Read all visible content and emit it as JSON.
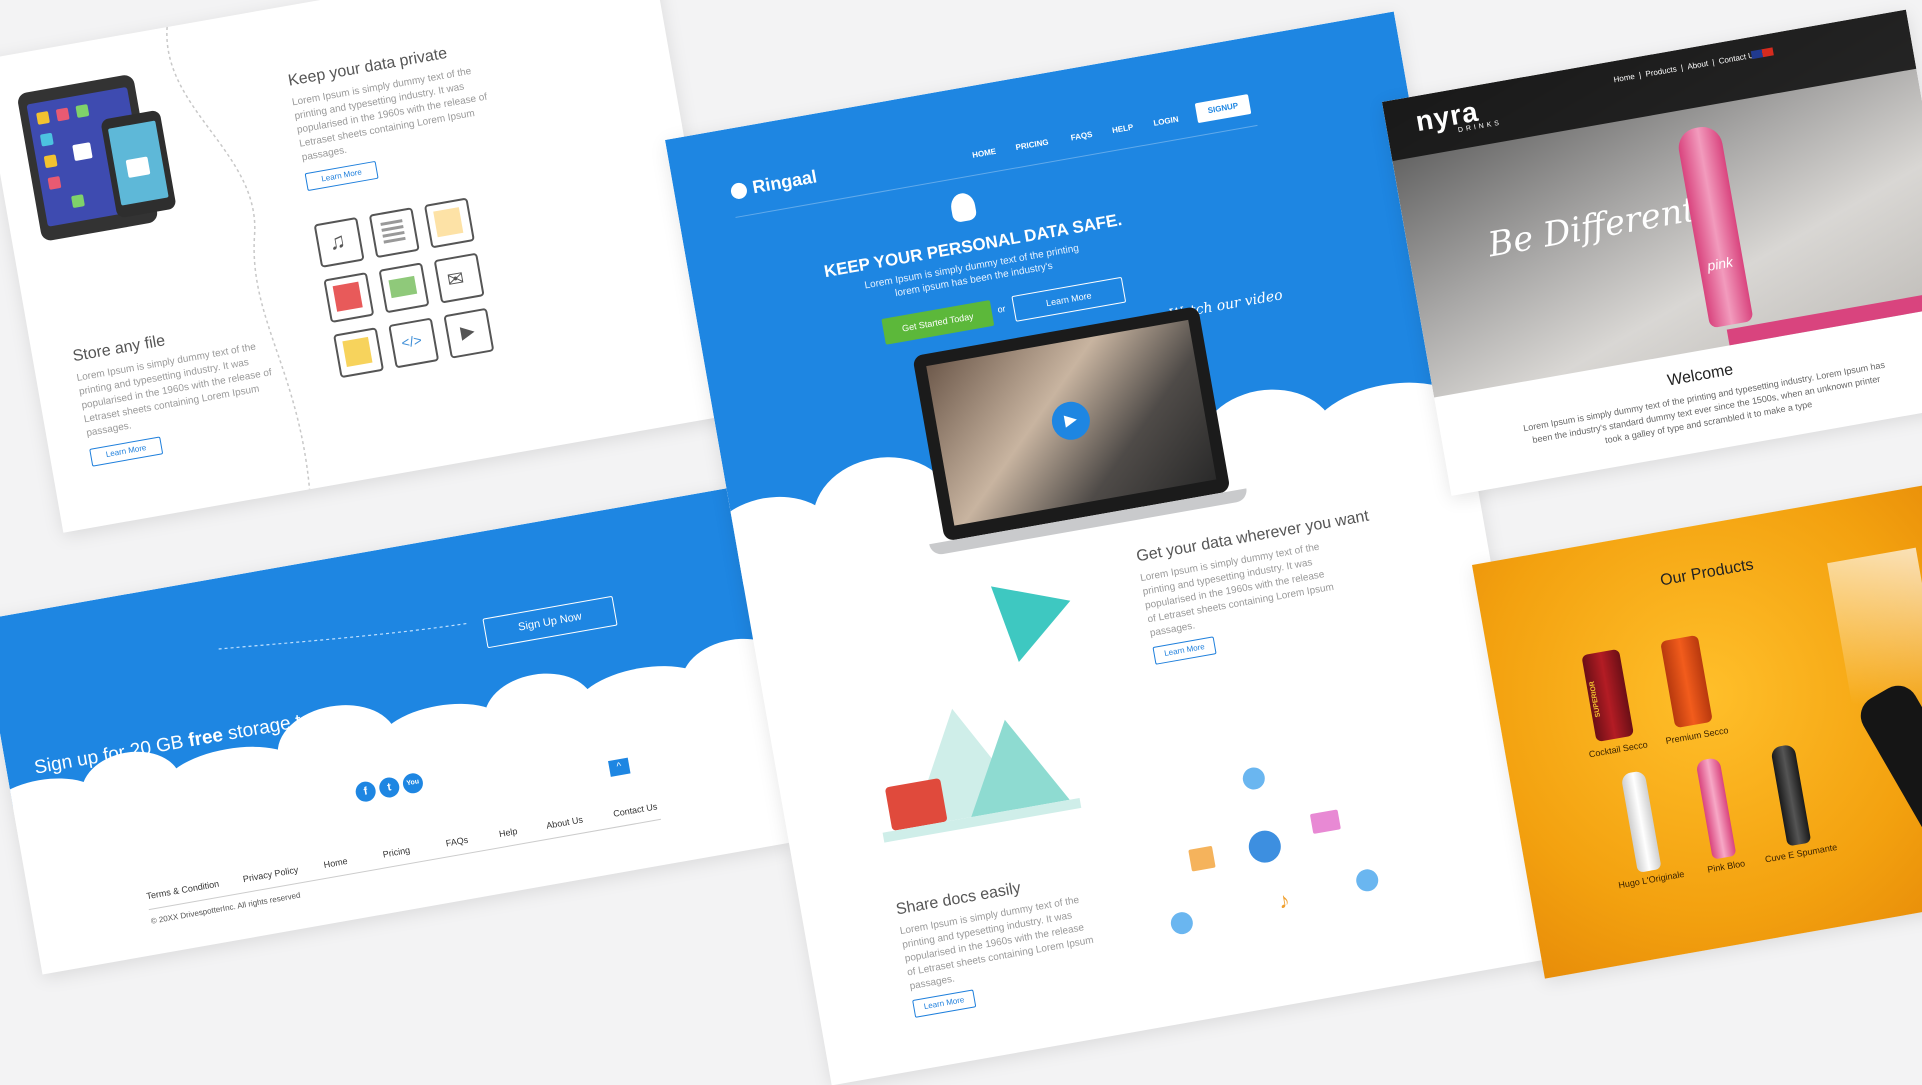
{
  "features": {
    "private_title": "Keep your data private",
    "private_text": "Lorem Ipsum is simply dummy text of the printing and typesetting industry. It was popularised in the 1960s with the release of Letraset sheets containing Lorem Ipsum passages.",
    "private_button": "Learn More",
    "store_title": "Store any file",
    "store_text": "Lorem Ipsum is simply dummy text of the printing and typesetting industry. It was popularised in the 1960s with the release of Letraset sheets containing Lorem Ipsum passages.",
    "store_button": "Learn More"
  },
  "signup": {
    "cta_button": "Sign Up Now",
    "tagline_pre": "Sign up for 20 GB ",
    "tagline_bold": "free",
    "tagline_post": " storage today.",
    "footer_links": [
      "Terms & Condition",
      "Privacy Policy",
      "Home",
      "Pricing",
      "FAQs",
      "Help",
      "About Us",
      "Contact Us"
    ],
    "copyright": "© 20XX DrivespotterInc. All rights reserved",
    "social": [
      "f",
      "t",
      "You"
    ]
  },
  "ringaal": {
    "brand": "Ringaal",
    "nav": [
      "HOME",
      "PRICING",
      "FAQS",
      "HELP",
      "LOGIN"
    ],
    "nav_signup": "SIGNUP",
    "hero_title": "KEEP YOUR PERSONAL DATA SAFE.",
    "hero_text": "Lorem Ipsum is simply dummy text of the printing lorem ipsum has been the industry's",
    "primary_button": "Get Started Today",
    "or": "or",
    "secondary_button": "Learn More",
    "video_caption": "Watch our video",
    "section1_title": "Get your data wherever you want",
    "section1_text": "Lorem Ipsum is simply dummy text of the printing and typesetting industry. It was popularised in the 1960s with the release of Letraset sheets containing Lorem Ipsum passages.",
    "section1_button": "Learn More",
    "section2_title": "Share docs easily",
    "section2_text": "Lorem Ipsum is simply dummy text of the printing and typesetting industry. It was popularised in the 1960s with the release of Letraset sheets containing Lorem Ipsum passages.",
    "section2_button": "Learn More",
    "colors": {
      "primary": "#1e86e2",
      "green": "#5cb83a"
    }
  },
  "nyra": {
    "logo": "nyra",
    "logo_sub": "DRINKS",
    "nav": [
      "Home",
      "Products",
      "About",
      "Contact Us"
    ],
    "hero_text": "Be Different",
    "bottle_label": "pink",
    "welcome_title": "Welcome",
    "welcome_text": "Lorem Ipsum is simply dummy text of the printing and typesetting industry. Lorem Ipsum has been the industry's standard dummy text ever since the 1500s, when an unknown printer took a galley of type and scrambled it to make a type"
  },
  "products": {
    "title": "Our Products",
    "items": [
      "Cocktail Secco",
      "Premium Secco",
      "Hugo L'Originale",
      "Pink Bloo",
      "Cuve E Spumante"
    ],
    "can_label": "SUPERIOR"
  }
}
